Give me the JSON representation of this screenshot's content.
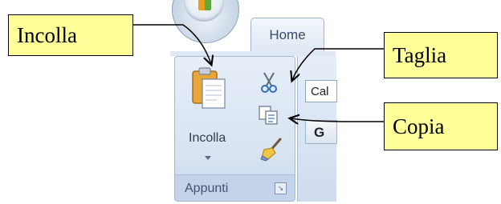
{
  "ribbon": {
    "active_tab": "Home",
    "font_box_text": "Cal",
    "bold_button": "G",
    "group": {
      "paste_label": "Incolla",
      "label": "Appunti",
      "launcher_icon": "dialog-launcher-icon"
    }
  },
  "callouts": {
    "paste": "Incolla",
    "cut": "Taglia",
    "copy": "Copia"
  },
  "colors": {
    "callout_bg": "#ffff99",
    "ribbon_bg": "#dfe8f3",
    "ribbon_border": "#a4b9d5"
  }
}
